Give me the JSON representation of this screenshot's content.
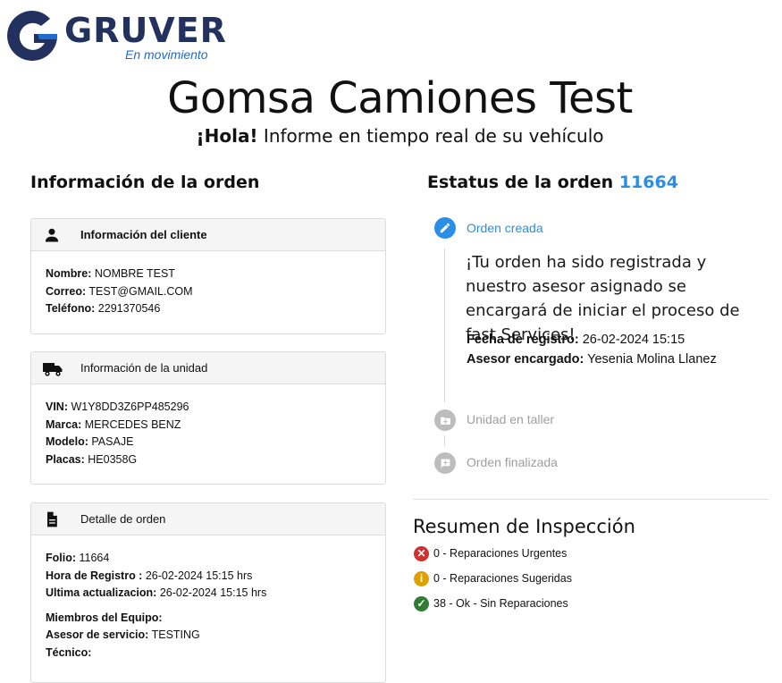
{
  "brand": {
    "name": "GRUVER",
    "tagline": "En movimiento",
    "colors": {
      "navy": "#23315f",
      "blue": "#1f6bd0"
    }
  },
  "header": {
    "title": "Gomsa Camiones Test",
    "greeting_bold": "¡Hola!",
    "greeting_rest": " Informe en tiempo real de su vehículo"
  },
  "left": {
    "heading": "Información de la orden",
    "cliente": {
      "title": "Información del cliente",
      "icon": "person-icon",
      "rows": [
        {
          "label": "Nombre:",
          "value": " NOMBRE TEST"
        },
        {
          "label": "Correo:",
          "value": " TEST@GMAIL.COM"
        },
        {
          "label": "Teléfono:",
          "value": " 2291370546"
        }
      ]
    },
    "unidad": {
      "title": "Información de la unidad",
      "icon": "truck-icon",
      "rows": [
        {
          "label": "VIN:",
          "value": " W1Y8DD3Z6PP485296"
        },
        {
          "label": "Marca:",
          "value": " MERCEDES BENZ"
        },
        {
          "label": "Modelo:",
          "value": " PASAJE"
        },
        {
          "label": "Placas:",
          "value": " HE0358G"
        }
      ]
    },
    "detalle": {
      "title": "Detalle de orden",
      "icon": "document-icon",
      "rows": [
        {
          "label": "Folio:",
          "value": " 11664"
        },
        {
          "label": "Hora de Registro :",
          "value": " 26-02-2024 15:15 hrs"
        },
        {
          "label": "Ultima actualizacion:",
          "value": " 26-02-2024 15:15 hrs"
        }
      ],
      "team": [
        {
          "label": "Miembros del Equipo:",
          "value": ""
        },
        {
          "label": "Asesor de servicio:",
          "value": " TESTING"
        },
        {
          "label": "Técnico:",
          "value": ""
        }
      ]
    }
  },
  "right": {
    "heading": "Estatus de la orden",
    "order_number": "11664",
    "timeline": [
      {
        "label": "Orden creada",
        "state": "active",
        "icon": "pencil-icon"
      },
      {
        "label": "Unidad en taller",
        "state": "inactive",
        "icon": "folder-plus-icon"
      },
      {
        "label": "Orden finalizada",
        "state": "inactive",
        "icon": "chat-plus-icon"
      }
    ],
    "message": "¡Tu orden ha sido registrada y nuestro asesor asignado se encargará de iniciar el proceso de fast Services!",
    "fecha_label": "Fecha de registro:",
    "fecha_value": " 26-02-2024 15:15",
    "asesor_label": "Asesor encargado:",
    "asesor_value": " Yesenia Molina Llanez",
    "resumen": {
      "heading": "Resumen de Inspección",
      "items": [
        {
          "text": "0 - Reparaciones Urgentes",
          "color": "#d32f2f",
          "icon": "error-icon"
        },
        {
          "text": "0 - Reparaciones Sugeridas",
          "color": "#e0a100",
          "icon": "info-icon"
        },
        {
          "text": "38 - Ok - Sin Reparaciones",
          "color": "#2e7d32",
          "icon": "check-icon"
        }
      ]
    }
  }
}
